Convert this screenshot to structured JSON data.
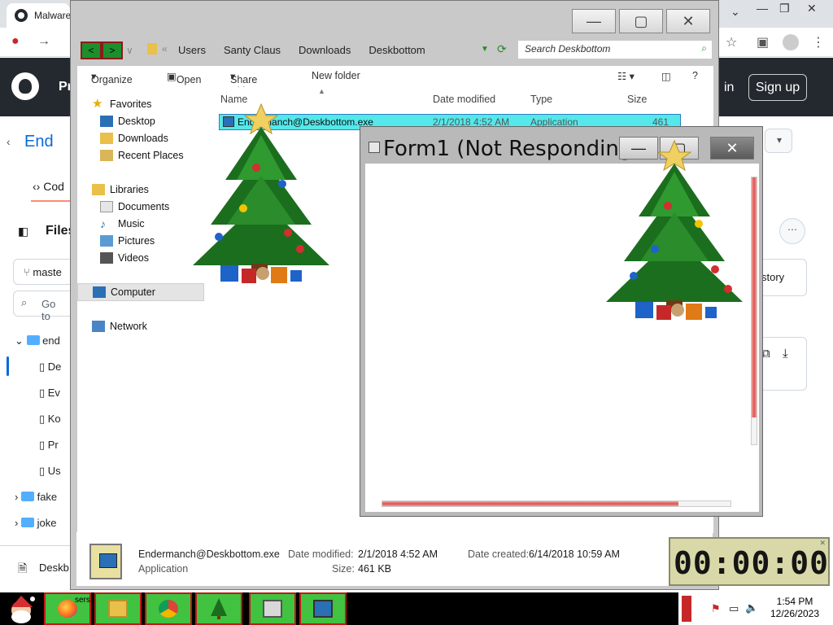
{
  "browser": {
    "tab_title": "Malware",
    "header_prefix": "Pr",
    "sign_in": "in",
    "sign_up": "Sign up",
    "repo_name": "End",
    "code_tab": "Cod",
    "files_label": "Files",
    "branch": "maste",
    "goto_file": "Go to",
    "tree": [
      "end",
      "De",
      "Ev",
      "Ko",
      "Pr",
      "Us",
      "fake",
      "joke"
    ],
    "history": "story",
    "deskb": "Deskb"
  },
  "explorer": {
    "window_buttons": {
      "minimize": "—",
      "maximize": "▢",
      "close": "✕"
    },
    "nav_back": "<",
    "nav_forward": ">",
    "breadcrumbs": [
      "Users",
      "Santy Claus",
      "Downloads",
      "Deskbottom"
    ],
    "search_placeholder": "Search Deskbottom",
    "toolbar": {
      "organize": "Organize",
      "open": "Open",
      "share_with": "Share with",
      "new_folder": "New folder"
    },
    "nav_pane": {
      "favorites": "Favorites",
      "favorites_items": [
        "Desktop",
        "Downloads",
        "Recent Places"
      ],
      "libraries": "Libraries",
      "libraries_items": [
        "Documents",
        "Music",
        "Pictures",
        "Videos"
      ],
      "computer": "Computer",
      "network": "Network"
    },
    "columns": {
      "name": "Name",
      "date_modified": "Date modified",
      "type": "Type",
      "size": "Size"
    },
    "file": {
      "name": "Endermanch@Deskbottom.exe",
      "date_modified": "2/1/2018 4:52 AM",
      "type": "Application",
      "size": "461"
    },
    "details": {
      "file_name": "Endermanch@Deskbottom.exe",
      "file_type": "Application",
      "date_modified_label": "Date modified:",
      "date_modified": "2/1/2018 4:52 AM",
      "size_label": "Size:",
      "size": "461 KB",
      "date_created_label": "Date created:",
      "date_created": "6/14/2018 10:59 AM"
    }
  },
  "form1": {
    "title": "Form1 (Not Responding)",
    "vertical_progress": 0.9,
    "horizontal_progress": 0.85,
    "progress_color": "#d9534f"
  },
  "timer": {
    "display": "00:00:00"
  },
  "taskbar": {
    "start_icon": "santa-icon",
    "apps": [
      "firefox-icon",
      "explorer-icon",
      "chrome-icon",
      "christmas-tree-icon",
      "computer-icon",
      "computer-icon"
    ],
    "app_overlay_label": "sers",
    "clock_time": "1:54 PM",
    "clock_date": "12/26/2023"
  },
  "colors": {
    "selection": "#54e8ea",
    "taskbar_button": "#41c241",
    "taskbar_border": "#c01818"
  }
}
